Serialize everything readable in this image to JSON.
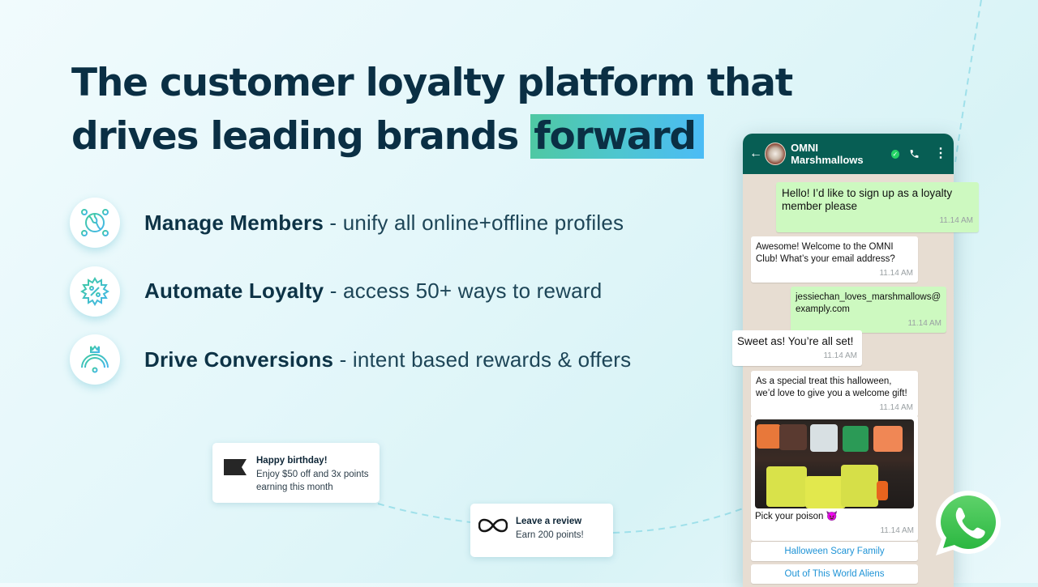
{
  "headline": {
    "line1": "The customer loyalty platform that",
    "line2_prefix": "drives leading brands ",
    "highlight": "forward"
  },
  "features": [
    {
      "icon": "puzzle-globe-icon",
      "title": "Manage Members",
      "description": " - unify all online+offline profiles"
    },
    {
      "icon": "percent-badge-icon",
      "title": "Automate Loyalty",
      "description": " - access 50+ ways to reward"
    },
    {
      "icon": "crown-gauge-icon",
      "title": "Drive Conversions",
      "description": " - intent based rewards & offers"
    }
  ],
  "cards": {
    "birthday": {
      "icon": "flag-icon",
      "title": "Happy birthday!",
      "body": "Enjoy $50 off and 3x points earning this month"
    },
    "review": {
      "icon": "infinity-icon",
      "title": "Leave a review",
      "body": "Earn 200 points!"
    }
  },
  "chat": {
    "contact_name": "OMNI Marshmallows",
    "verified": true,
    "messages": [
      {
        "direction": "outgoing",
        "text": "Hello! I’d like to sign up as a loyalty member please",
        "time": "11.14 AM"
      },
      {
        "direction": "incoming",
        "text": "Awesome! Welcome to the OMNI Club! What’s your email address?",
        "time": "11.14 AM"
      },
      {
        "direction": "outgoing",
        "text": "jessiechan_loves_marshmallows@ examply.com",
        "time": "11.14 AM"
      },
      {
        "direction": "incoming",
        "text": "Sweet as! You’re all set!",
        "time": "11.14 AM"
      },
      {
        "direction": "incoming",
        "text": "As a special treat this halloween, we’d love to give you a welcome gift!",
        "time": "11.14 AM"
      },
      {
        "direction": "incoming",
        "image": "halloween-marshmallow-pops",
        "text": "Pick your poison 😈",
        "time": "11.14 AM"
      }
    ],
    "quick_replies": [
      "Halloween Scary Family",
      "Out of This World Aliens"
    ]
  },
  "colors": {
    "headline": "#0a2f44",
    "whatsapp_header": "#075e54",
    "outgoing_bubble": "#cdf9c0",
    "quick_reply_text": "#1e93d6",
    "whatsapp_green": "#25d366"
  }
}
